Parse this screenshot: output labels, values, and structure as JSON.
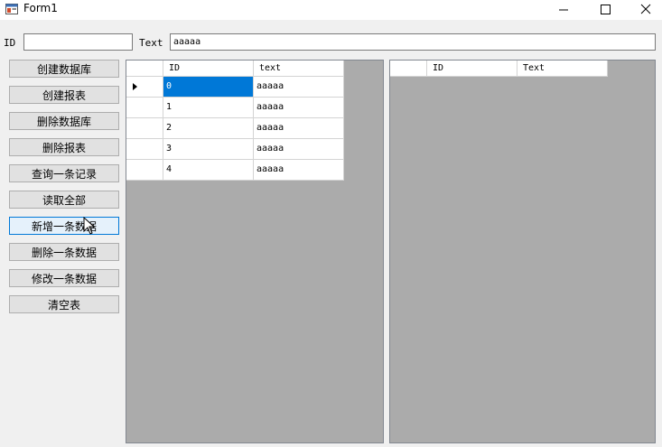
{
  "window": {
    "title": "Form1"
  },
  "inputs": {
    "id_label": "ID",
    "id_value": "",
    "text_label": "Text",
    "text_value": "aaaaa"
  },
  "buttons": [
    {
      "label": "创建数据库"
    },
    {
      "label": "创建报表"
    },
    {
      "label": "删除数据库"
    },
    {
      "label": "删除报表"
    },
    {
      "label": "查询一条记录"
    },
    {
      "label": "读取全部"
    },
    {
      "label": "新增一条数据"
    },
    {
      "label": "删除一条数据"
    },
    {
      "label": "修改一条数据"
    },
    {
      "label": "清空表"
    }
  ],
  "grid_left": {
    "columns": [
      "ID",
      "text"
    ],
    "rows": [
      [
        "0",
        "aaaaa"
      ],
      [
        "1",
        "aaaaa"
      ],
      [
        "2",
        "aaaaa"
      ],
      [
        "3",
        "aaaaa"
      ],
      [
        "4",
        "aaaaa"
      ]
    ]
  },
  "grid_right": {
    "columns": [
      "ID",
      "Text"
    ],
    "rows": []
  },
  "colors": {
    "selection": "#0078d7",
    "grid_background": "#ababab",
    "form_background": "#f0f0f0"
  }
}
